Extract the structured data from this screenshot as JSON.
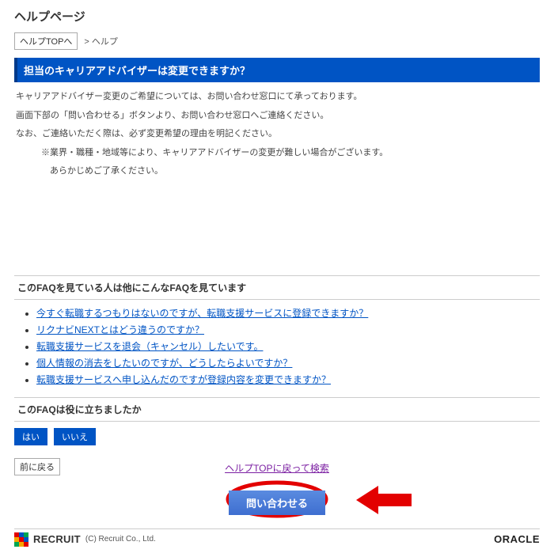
{
  "page": {
    "title": "ヘルプページ",
    "help_top_btn": "ヘルプTOPへ",
    "breadcrumb_current": "> ヘルプ"
  },
  "article": {
    "heading": "担当のキャリアアドバイザーは変更できますか？",
    "p1": "キャリアアドバイザー変更のご希望については、お問い合わせ窓口にて承っております。",
    "p2": "画面下部の「問い合わせる」ボタンより、お問い合わせ窓口へご連絡ください。",
    "p3": "なお、ご連絡いただく際は、必ず変更希望の理由を明記ください。",
    "p4": "※業界・職種・地域等により、キャリアアドバイザーの変更が難しい場合がございます。",
    "p5": "　あらかじめご了承ください。"
  },
  "related": {
    "heading": "このFAQを見ている人は他にこんなFAQを見ています",
    "items": [
      "今すぐ転職するつもりはないのですが、転職支援サービスに登録できますか？",
      "リクナビNEXTとはどう違うのですか？",
      "転職支援サービスを退会（キャンセル）したいです。",
      "個人情報の消去をしたいのですが、どうしたらよいですか？",
      "転職支援サービスへ申し込んだのですが登録内容を変更できますか？"
    ]
  },
  "vote": {
    "heading": "このFAQは役に立ちましたか",
    "yes": "はい",
    "no": "いいえ"
  },
  "nav": {
    "back": "前に戻る",
    "top_search": "ヘルプTOPに戻って検索",
    "contact": "問い合わせる"
  },
  "footer": {
    "recruit": "RECRUIT",
    "copyright": "(C) Recruit Co., Ltd.",
    "oracle": "ORACLE"
  }
}
